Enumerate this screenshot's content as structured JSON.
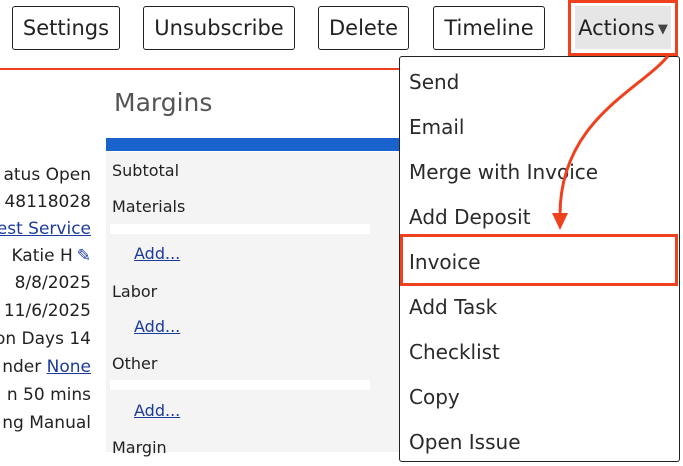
{
  "toolbar": {
    "settings": "Settings",
    "unsubscribe": "Unsubscribe",
    "delete": "Delete",
    "timeline": "Timeline",
    "actions": "Actions"
  },
  "details": {
    "status": "atus Open",
    "number": "48118028",
    "service_link": "est Service",
    "assignee": "Katie H",
    "date1": "8/8/2025",
    "date2": "11/6/2025",
    "days": "on Days 14",
    "reminder_label": "nder",
    "reminder_value": "None",
    "duration": "n 50 mins",
    "billing": "ng Manual"
  },
  "margins": {
    "title": "Margins",
    "subtotal": "Subtotal",
    "materials": "Materials",
    "add1": "Add...",
    "labor": "Labor",
    "add2": "Add...",
    "other": "Other",
    "add3": "Add...",
    "margin": "Margin"
  },
  "menu": {
    "items": [
      "Send",
      "Email",
      "Merge with Invoice",
      "Add Deposit",
      "Invoice",
      "Add Task",
      "Checklist",
      "Copy",
      "Open Issue"
    ]
  },
  "colors": {
    "highlight": "#f0411e",
    "accent_bar": "#1a62cc",
    "link": "#1b3a9a"
  }
}
